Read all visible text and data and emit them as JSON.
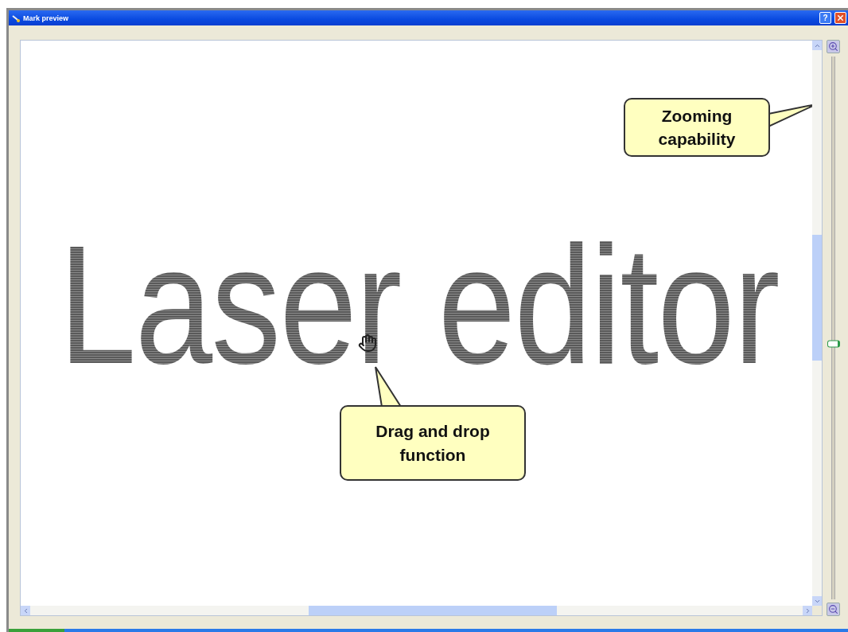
{
  "window": {
    "title": "Mark preview",
    "help_glyph": "?"
  },
  "canvas": {
    "text": "Laser editor"
  },
  "callouts": [
    {
      "kind": "right",
      "text": "Zooming capability"
    },
    {
      "kind": "up",
      "text": "Drag and drop function"
    }
  ],
  "zoom_slider": {
    "level": 0.47
  }
}
